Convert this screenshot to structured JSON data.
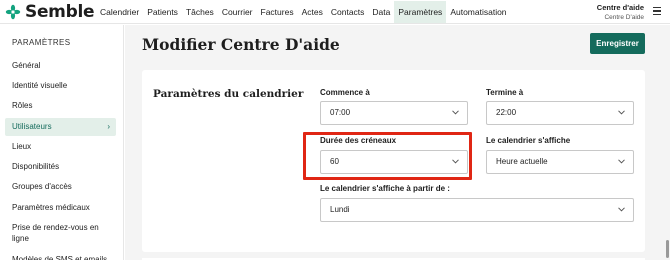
{
  "app": {
    "brand": "Semble"
  },
  "nav": {
    "items": [
      "Calendrier",
      "Patients",
      "Tâches",
      "Courrier",
      "Factures",
      "Actes",
      "Contacts",
      "Data",
      "Paramètres",
      "Automatisation"
    ],
    "active_index": 8
  },
  "account": {
    "centre_name": "Centre d'aide",
    "centre_sub": "Centre D'aide"
  },
  "sidebar": {
    "heading": "PARAMÈTRES",
    "items": [
      "Général",
      "Identité visuelle",
      "Rôles",
      "Utilisateurs",
      "Lieux",
      "Disponibilités",
      "Groupes d'accès",
      "Paramètres médicaux",
      "Prise de rendez-vous en ligne",
      "Modèles de SMS et emails"
    ],
    "active_index": 3
  },
  "main": {
    "title": "Modifier Centre D'aide",
    "save_label": "Enregistrer",
    "section_title": "Paramètres du calendrier",
    "fields": {
      "start": {
        "label": "Commence à",
        "value": "07:00"
      },
      "end": {
        "label": "Termine à",
        "value": "22:00"
      },
      "slot": {
        "label": "Durée des créneaux",
        "value": "60"
      },
      "display": {
        "label": "Le calendrier s'affiche",
        "value": "Heure actuelle"
      },
      "display_from": {
        "label": "Le calendrier s'affiche à partir de :",
        "value": "Lundi"
      }
    }
  },
  "colors": {
    "brand": "#146b5c",
    "active_bg": "#e3efe9",
    "highlight": "#e02614"
  },
  "icons": {
    "logo": "semble-logo-icon",
    "menu": "hamburger-menu-icon",
    "select": "chevron-down-icon",
    "active_item": "chevron-right-icon"
  }
}
